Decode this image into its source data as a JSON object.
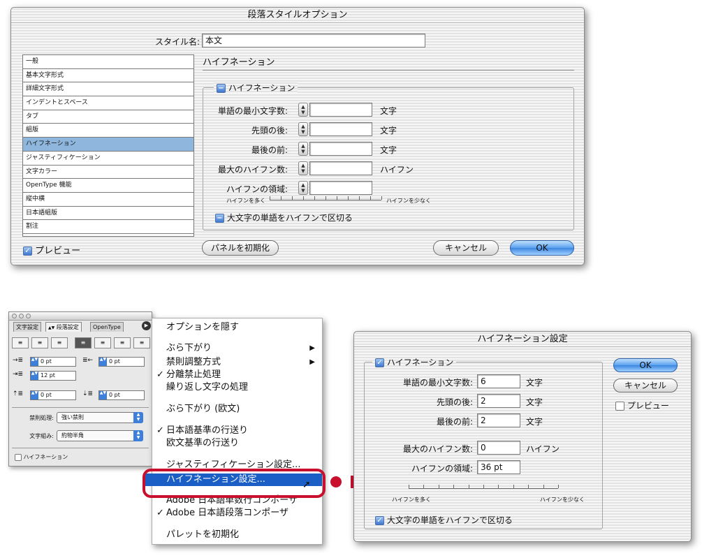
{
  "top_dialog": {
    "title": "段落スタイルオプション",
    "style_name_label": "スタイル名:",
    "style_name_value": "本文",
    "categories": [
      "一般",
      "基本文字形式",
      "詳細文字形式",
      "インデントとスペース",
      "タブ",
      "組版",
      "ハイフネーション",
      "ジャスティフィケーション",
      "文字カラー",
      "OpenType 機能",
      "縦中横",
      "日本語組版",
      "割注"
    ],
    "selected_category": "ハイフネーション",
    "section_title": "ハイフネーション",
    "group_label": "ハイフネーション",
    "fields": [
      {
        "label": "単語の最小文字数:",
        "value": "",
        "unit": "文字"
      },
      {
        "label": "先頭の後:",
        "value": "",
        "unit": "文字"
      },
      {
        "label": "最後の前:",
        "value": "",
        "unit": "文字"
      },
      {
        "label": "最大のハイフン数:",
        "value": "",
        "unit": "ハイフン"
      },
      {
        "label": "ハイフンの領域:",
        "value": "",
        "unit": ""
      }
    ],
    "slider_left": "ハイフンを多く",
    "slider_right": "ハイフンを少なく",
    "capitalized_label": "大文字の単語をハイフンで区切る",
    "preview_label": "プレビュー",
    "reset_button": "パネルを初期化",
    "cancel_button": "キャンセル",
    "ok_button": "OK"
  },
  "paragraph_panel": {
    "tabs": [
      "文字設定",
      "段落設定",
      "OpenType"
    ],
    "align_buttons": [
      "≡",
      "≡",
      "≡",
      "≡",
      "≡",
      "≡",
      "≡"
    ],
    "left_indent": "0 pt",
    "right_indent": "0 pt",
    "first_line_indent": "12 pt",
    "space_before": "0 pt",
    "space_after": "0 pt",
    "kinsoku_label": "禁則処理:",
    "kinsoku_value": "強い禁則",
    "mojikumi_label": "文字組み:",
    "mojikumi_value": "約物半角",
    "hyphenation_label": "ハイフネーション"
  },
  "menu": {
    "items": [
      {
        "label": "オプションを隠す",
        "check": "",
        "submenu": ""
      },
      {
        "label": "ぶら下がり",
        "check": "",
        "submenu": "▶"
      },
      {
        "label": "禁則調整方式",
        "check": "",
        "submenu": "▶"
      },
      {
        "label": "分離禁止処理",
        "check": "✓",
        "submenu": ""
      },
      {
        "label": "繰り返し文字の処理",
        "check": "",
        "submenu": ""
      },
      {
        "label": "ぶら下がり (欧文)",
        "check": "",
        "submenu": ""
      },
      {
        "label": "日本語基準の行送り",
        "check": "✓",
        "submenu": ""
      },
      {
        "label": "欧文基準の行送り",
        "check": "",
        "submenu": ""
      },
      {
        "label": "ジャスティフィケーション設定...",
        "check": "",
        "submenu": ""
      },
      {
        "label": "ハイフネーション設定...",
        "check": "",
        "submenu": ""
      },
      {
        "label": "Adobe 日本語単数行コンポーザ",
        "check": "",
        "submenu": ""
      },
      {
        "label": "Adobe 日本語段落コンポーザ",
        "check": "✓",
        "submenu": ""
      },
      {
        "label": "パレットを初期化",
        "check": "",
        "submenu": ""
      }
    ],
    "highlighted": "ハイフネーション設定..."
  },
  "hyph_dialog": {
    "title": "ハイフネーション設定",
    "group_label": "ハイフネーション",
    "fields": [
      {
        "label": "単語の最小文字数:",
        "value": "6",
        "unit": "文字"
      },
      {
        "label": "先頭の後:",
        "value": "2",
        "unit": "文字"
      },
      {
        "label": "最後の前:",
        "value": "2",
        "unit": "文字"
      },
      {
        "label": "最大のハイフン数:",
        "value": "0",
        "unit": "ハイフン"
      },
      {
        "label": "ハイフンの領域:",
        "value": "36 pt",
        "unit": ""
      }
    ],
    "slider_left": "ハイフンを多く",
    "slider_right": "ハイフンを少なく",
    "capitalized_label": "大文字の単語をハイフンで区切る",
    "ok_button": "OK",
    "cancel_button": "キャンセル",
    "preview_label": "プレビュー"
  },
  "colors": {
    "accent": "#1a5ec6",
    "callout_red": "#c8102e",
    "list_selection": "#8fb6dd"
  }
}
